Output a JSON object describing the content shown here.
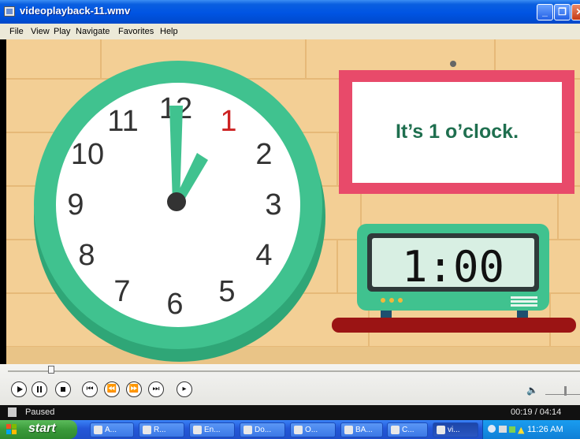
{
  "window": {
    "title": "videoplayback-11.wmv",
    "min_icon": "minimize-icon",
    "max_icon": "restore-icon",
    "close_icon": "close-icon"
  },
  "menu": [
    "File",
    "View",
    "Play",
    "Navigate",
    "Favorites",
    "Help"
  ],
  "video": {
    "clock_numbers": [
      "12",
      "1",
      "2",
      "3",
      "4",
      "5",
      "6",
      "7",
      "8",
      "9",
      "10",
      "11"
    ],
    "caption": "It’s 1 o’clock.",
    "digital_time": "1:00",
    "colors": {
      "wall": "#f3cf95",
      "clock_rim": "#40c28f",
      "frame": "#e84a6a",
      "clock_text": "#1f6f4f",
      "highlight_number": "#cc2222",
      "shelf": "#9b1414"
    }
  },
  "controls": {
    "buttons": [
      "play-icon",
      "pause-icon",
      "stop-icon",
      "previous-icon",
      "rewind-icon",
      "fast-forward-icon",
      "next-icon",
      "frame-step-icon"
    ],
    "volume_icon": "speaker-icon",
    "seek_fraction": 0.076
  },
  "status": {
    "state": "Paused",
    "time": "00:19 / 04:14"
  },
  "taskbar": {
    "start_label": "start",
    "items": [
      "A...",
      "R...",
      "En...",
      "Do...",
      "O...",
      "BA...",
      "C...",
      "vi..."
    ],
    "clock": "11:26 AM"
  }
}
